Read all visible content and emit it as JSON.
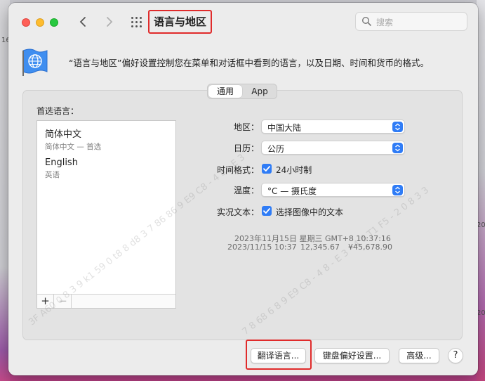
{
  "window": {
    "title": "语言与地区",
    "search_placeholder": "搜索",
    "description": "“语言与地区”偏好设置控制您在菜单和对话框中看到的语言，以及日期、时间和货币的格式。"
  },
  "desktop": {
    "side_labels": [
      "16",
      "20",
      "20"
    ]
  },
  "tabs": [
    {
      "label": "通用",
      "active": true
    },
    {
      "label": "App",
      "active": false
    }
  ],
  "preferred_languages": {
    "label": "首选语言：",
    "items": [
      {
        "name": "简体中文",
        "sub": "简体中文 — 首选"
      },
      {
        "name": "English",
        "sub": "英语"
      }
    ],
    "add_label": "+",
    "remove_label": "−"
  },
  "settings": {
    "region": {
      "label": "地区：",
      "value": "中国大陆"
    },
    "calendar": {
      "label": "日历：",
      "value": "公历"
    },
    "time_format": {
      "label": "时间格式：",
      "value": "24小时制",
      "checked": true
    },
    "temperature": {
      "label": "温度：",
      "value": "°C — 摄氏度"
    },
    "live_text": {
      "label": "实况文本：",
      "value": "选择图像中的文本",
      "checked": true
    }
  },
  "sample": {
    "line1": "2023年11月15日 星期三 GMT+8 10:37:16",
    "line2_date": "2023/11/15 10:37",
    "line2_number": "12,345.67",
    "line2_currency": "¥45,678.90"
  },
  "buttons": {
    "translate": "翻译语言...",
    "keyboard": "键盘偏好设置...",
    "advanced": "高级...",
    "help": "?"
  },
  "colors": {
    "accent": "#2f7cf6",
    "highlight": "#e02b2b"
  }
}
